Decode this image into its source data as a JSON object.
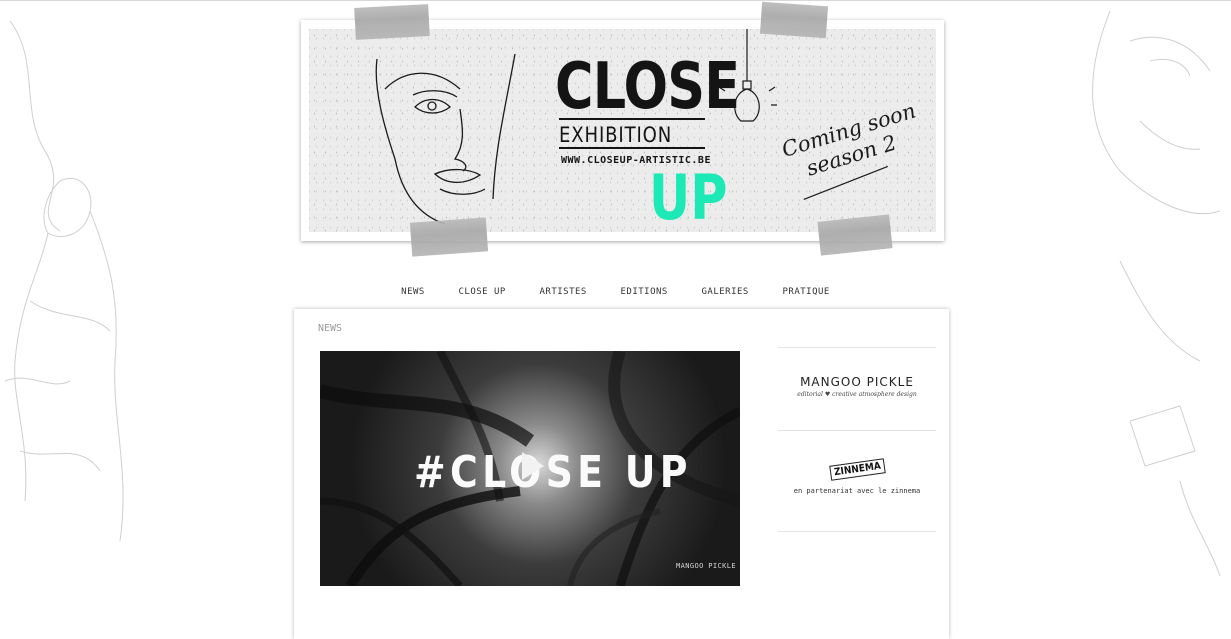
{
  "banner": {
    "title_close": "CLOSE",
    "title_exhibition": "EXHIBITION",
    "url": "WWW.CLOSEUP-ARTISTIC.BE",
    "title_up": "UP",
    "coming_soon": "Coming soon",
    "season": "season 2",
    "accent_color": "#1de9b6"
  },
  "nav": {
    "items": [
      "NEWS",
      "CLOSE UP",
      "ARTISTES",
      "EDITIONS",
      "GALERIES",
      "PRATIQUE"
    ]
  },
  "content": {
    "section_title": "NEWS",
    "video": {
      "overlay_text": "#CLOSE UP",
      "watermark": "MANGOO PICKLE",
      "play_icon": "play-icon"
    }
  },
  "sidebar": {
    "sponsor1": {
      "name": "MANGOO PICKLE",
      "tagline": "editorial ♥ creative atmosphere design"
    },
    "sponsor2": {
      "logo_text": "ZINNEMA",
      "caption": "en partenariat avec le zinnema"
    }
  }
}
